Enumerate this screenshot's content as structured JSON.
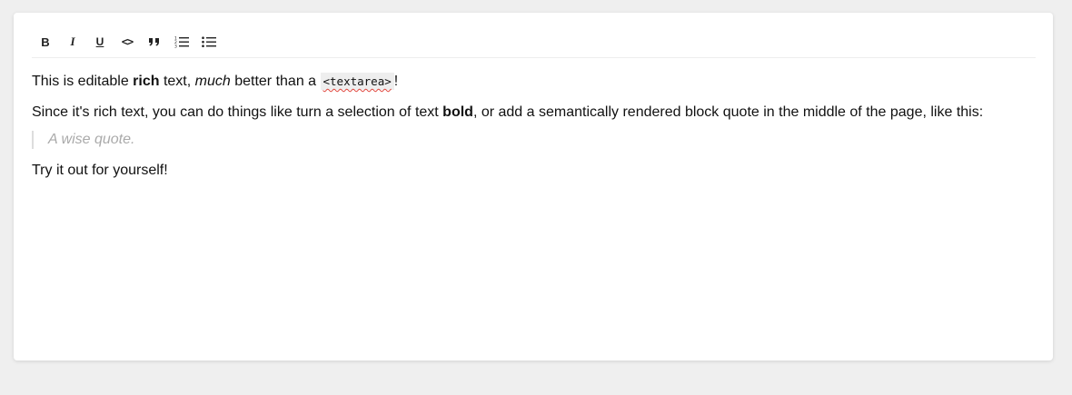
{
  "toolbar": {
    "buttons": [
      {
        "name": "bold",
        "icon": "bold-icon"
      },
      {
        "name": "italic",
        "icon": "italic-icon"
      },
      {
        "name": "underline",
        "icon": "underline-icon"
      },
      {
        "name": "code",
        "icon": "code-icon"
      },
      {
        "name": "block-quote",
        "icon": "quote-icon"
      },
      {
        "name": "numbered-list",
        "icon": "numbered-list-icon"
      },
      {
        "name": "bulleted-list",
        "icon": "bulleted-list-icon"
      }
    ],
    "labels": {
      "bold": "B",
      "italic": "I",
      "underline": "U",
      "code": "<>"
    }
  },
  "content": {
    "p1": {
      "t1": "This is editable ",
      "bold": "rich",
      "t2": " text, ",
      "italic": "much",
      "t3": " better than a ",
      "code": "<textarea>",
      "t4": "!"
    },
    "p2": {
      "t1": "Since it's rich text, you can do things like turn a selection of text ",
      "bold": "bold",
      "t2": ", or add a semantically rendered block quote in the middle of the page, like this:"
    },
    "quote": "A wise quote.",
    "p3": "Try it out for yourself!"
  },
  "colors": {
    "page_bg": "#efefef",
    "editor_bg": "#ffffff",
    "text": "#111111",
    "quote_text": "#aaaaaa",
    "quote_border": "#dddddd",
    "code_bg": "#eeeeee",
    "spellcheck": "#e0463d"
  }
}
